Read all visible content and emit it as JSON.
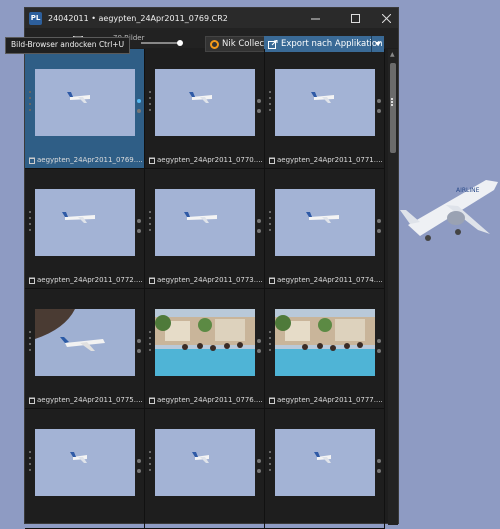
{
  "window": {
    "title": "24042011 • aegypten_24Apr2011_0769.CR2",
    "app_logo": "PL"
  },
  "toolbar": {
    "tooltip": "Bild-Browser andocken   Ctrl+U",
    "count": "70 Bilder",
    "nik_label": "Nik Collection",
    "export_label": "Export nach Applikation"
  },
  "thumbnails": [
    {
      "filename": "aegypten_24Apr2011_0769....",
      "selected": true
    },
    {
      "filename": "aegypten_24Apr2011_0770...."
    },
    {
      "filename": "aegypten_24Apr2011_0771...."
    },
    {
      "filename": "aegypten_24Apr2011_0772...."
    },
    {
      "filename": "aegypten_24Apr2011_0773...."
    },
    {
      "filename": "aegypten_24Apr2011_0774...."
    },
    {
      "filename": "aegypten_24Apr2011_0775...."
    },
    {
      "filename": "aegypten_24Apr2011_0776...."
    },
    {
      "filename": "aegypten_24Apr2011_0777...."
    },
    {
      "filename": ""
    },
    {
      "filename": ""
    },
    {
      "filename": ""
    }
  ],
  "colors": {
    "desktop": "#8e9bc3",
    "selection": "#2f5e86",
    "export_button": "#3a6a96"
  }
}
